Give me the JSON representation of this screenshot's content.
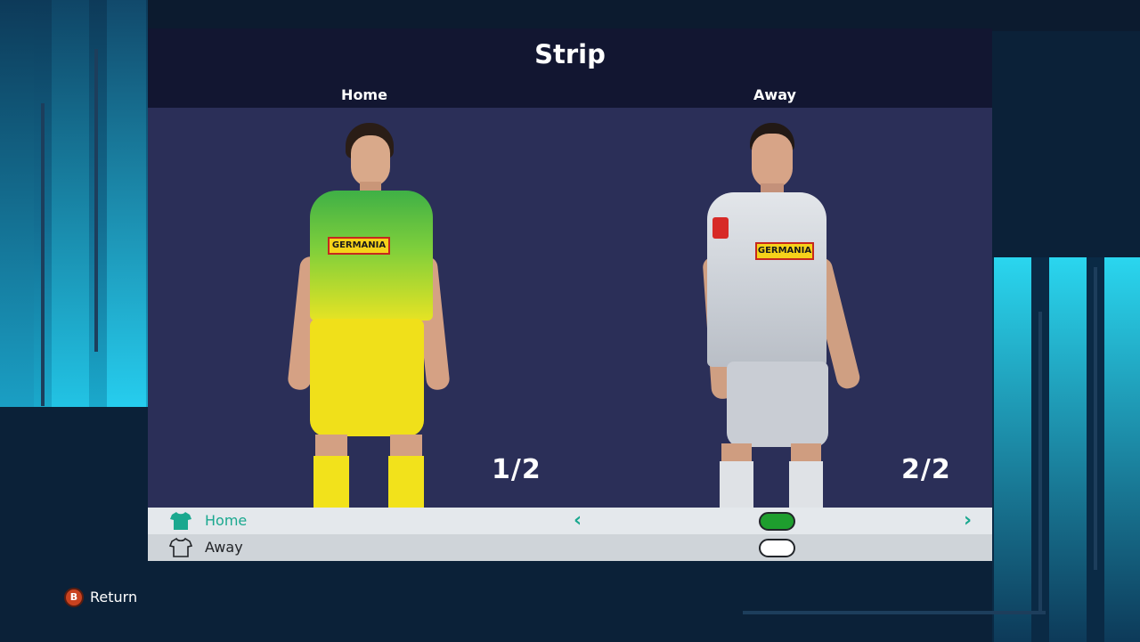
{
  "screen": {
    "title": "Strip"
  },
  "columns": {
    "home_label": "Home",
    "away_label": "Away"
  },
  "kits": {
    "home_count": "1/2",
    "away_count": "2/2",
    "home_sponsor": "GERMANIA",
    "away_sponsor": "GERMANIA"
  },
  "selection": {
    "rows": [
      {
        "label": "Home",
        "toggle": "on",
        "icon": "shirt-filled-icon"
      },
      {
        "label": "Away",
        "toggle": "off",
        "icon": "shirt-outline-icon"
      }
    ],
    "prev_arrow": "‹",
    "next_arrow": "›"
  },
  "footer": {
    "button_glyph": "B",
    "return_label": "Return"
  },
  "colors": {
    "accent": "#1aa88f",
    "toggle_on": "#1e9e2e",
    "home_shirt": "#5fc43a",
    "home_shorts": "#f2e21b",
    "away_shirt": "#d9dde2",
    "panel": "#2b2f58"
  }
}
